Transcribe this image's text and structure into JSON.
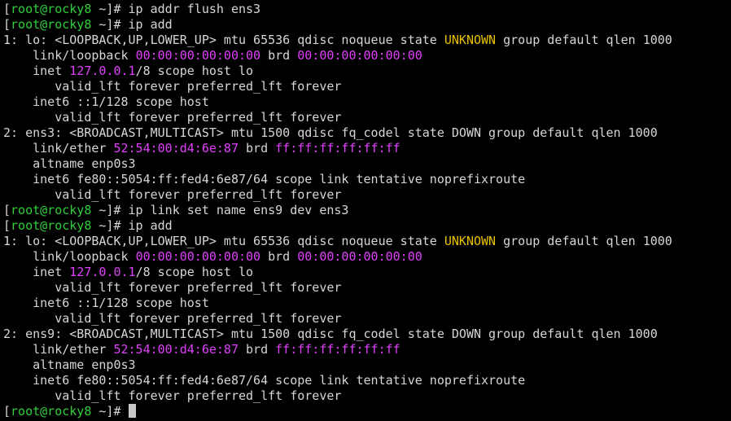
{
  "prompt": {
    "open": "[",
    "user_host": "root@rocky8",
    "dir": " ~]# "
  },
  "lines": [
    {
      "type": "prompt",
      "cmd": "ip addr flush ens3"
    },
    {
      "type": "prompt",
      "cmd": "ip add"
    },
    {
      "type": "output",
      "segments": [
        {
          "t": "1: lo: <LOOPBACK,UP,LOWER_UP> mtu 65536 qdisc noqueue state ",
          "c": "n"
        },
        {
          "t": "UNKNOWN",
          "c": "y"
        },
        {
          "t": " group default qlen 1000",
          "c": "n"
        }
      ]
    },
    {
      "type": "output",
      "segments": [
        {
          "t": "    link/loopback ",
          "c": "n"
        },
        {
          "t": "00:00:00:00:00:00",
          "c": "m"
        },
        {
          "t": " brd ",
          "c": "n"
        },
        {
          "t": "00:00:00:00:00:00",
          "c": "m"
        }
      ]
    },
    {
      "type": "output",
      "segments": [
        {
          "t": "    inet ",
          "c": "n"
        },
        {
          "t": "127.0.0.1",
          "c": "m"
        },
        {
          "t": "/8 scope host lo",
          "c": "n"
        }
      ]
    },
    {
      "type": "output",
      "segments": [
        {
          "t": "       valid_lft forever preferred_lft forever",
          "c": "n"
        }
      ]
    },
    {
      "type": "output",
      "segments": [
        {
          "t": "    inet6 ::1/128 scope host",
          "c": "n"
        }
      ]
    },
    {
      "type": "output",
      "segments": [
        {
          "t": "       valid_lft forever preferred_lft forever",
          "c": "n"
        }
      ]
    },
    {
      "type": "output",
      "segments": [
        {
          "t": "2: ens3: <BROADCAST,MULTICAST> mtu 1500 qdisc fq_codel state DOWN group default qlen 1000",
          "c": "n"
        }
      ]
    },
    {
      "type": "output",
      "segments": [
        {
          "t": "    link/ether ",
          "c": "n"
        },
        {
          "t": "52:54:00:d4:6e:87",
          "c": "m"
        },
        {
          "t": " brd ",
          "c": "n"
        },
        {
          "t": "ff:ff:ff:ff:ff:ff",
          "c": "m"
        }
      ]
    },
    {
      "type": "output",
      "segments": [
        {
          "t": "    altname enp0s3",
          "c": "n"
        }
      ]
    },
    {
      "type": "output",
      "segments": [
        {
          "t": "    inet6 fe80::5054:ff:fed4:6e87/64 scope link tentative noprefixroute",
          "c": "n"
        }
      ]
    },
    {
      "type": "output",
      "segments": [
        {
          "t": "       valid_lft forever preferred_lft forever",
          "c": "n"
        }
      ]
    },
    {
      "type": "prompt",
      "cmd": "ip link set name ens9 dev ens3"
    },
    {
      "type": "prompt",
      "cmd": "ip add"
    },
    {
      "type": "output",
      "segments": [
        {
          "t": "1: lo: <LOOPBACK,UP,LOWER_UP> mtu 65536 qdisc noqueue state ",
          "c": "n"
        },
        {
          "t": "UNKNOWN",
          "c": "y"
        },
        {
          "t": " group default qlen 1000",
          "c": "n"
        }
      ]
    },
    {
      "type": "output",
      "segments": [
        {
          "t": "    link/loopback ",
          "c": "n"
        },
        {
          "t": "00:00:00:00:00:00",
          "c": "m"
        },
        {
          "t": " brd ",
          "c": "n"
        },
        {
          "t": "00:00:00:00:00:00",
          "c": "m"
        }
      ]
    },
    {
      "type": "output",
      "segments": [
        {
          "t": "    inet ",
          "c": "n"
        },
        {
          "t": "127.0.0.1",
          "c": "m"
        },
        {
          "t": "/8 scope host lo",
          "c": "n"
        }
      ]
    },
    {
      "type": "output",
      "segments": [
        {
          "t": "       valid_lft forever preferred_lft forever",
          "c": "n"
        }
      ]
    },
    {
      "type": "output",
      "segments": [
        {
          "t": "    inet6 ::1/128 scope host",
          "c": "n"
        }
      ]
    },
    {
      "type": "output",
      "segments": [
        {
          "t": "       valid_lft forever preferred_lft forever",
          "c": "n"
        }
      ]
    },
    {
      "type": "output",
      "segments": [
        {
          "t": "2: ens9: <BROADCAST,MULTICAST> mtu 1500 qdisc fq_codel state DOWN group default qlen 1000",
          "c": "n"
        }
      ]
    },
    {
      "type": "output",
      "segments": [
        {
          "t": "    link/ether ",
          "c": "n"
        },
        {
          "t": "52:54:00:d4:6e:87",
          "c": "m"
        },
        {
          "t": " brd ",
          "c": "n"
        },
        {
          "t": "ff:ff:ff:ff:ff:ff",
          "c": "m"
        }
      ]
    },
    {
      "type": "output",
      "segments": [
        {
          "t": "    altname enp0s3",
          "c": "n"
        }
      ]
    },
    {
      "type": "output",
      "segments": [
        {
          "t": "    inet6 fe80::5054:ff:fed4:6e87/64 scope link tentative noprefixroute",
          "c": "n"
        }
      ]
    },
    {
      "type": "output",
      "segments": [
        {
          "t": "       valid_lft forever preferred_lft forever",
          "c": "n"
        }
      ]
    },
    {
      "type": "prompt",
      "cmd": "",
      "cursor": true
    }
  ],
  "colors": {
    "background": "#000000",
    "text": "#d6d6d6",
    "prompt_user_host": "#2fcf3a",
    "highlight_magenta": "#e040fb",
    "highlight_yellow": "#e8c100",
    "cursor": "#c8c8c8"
  }
}
